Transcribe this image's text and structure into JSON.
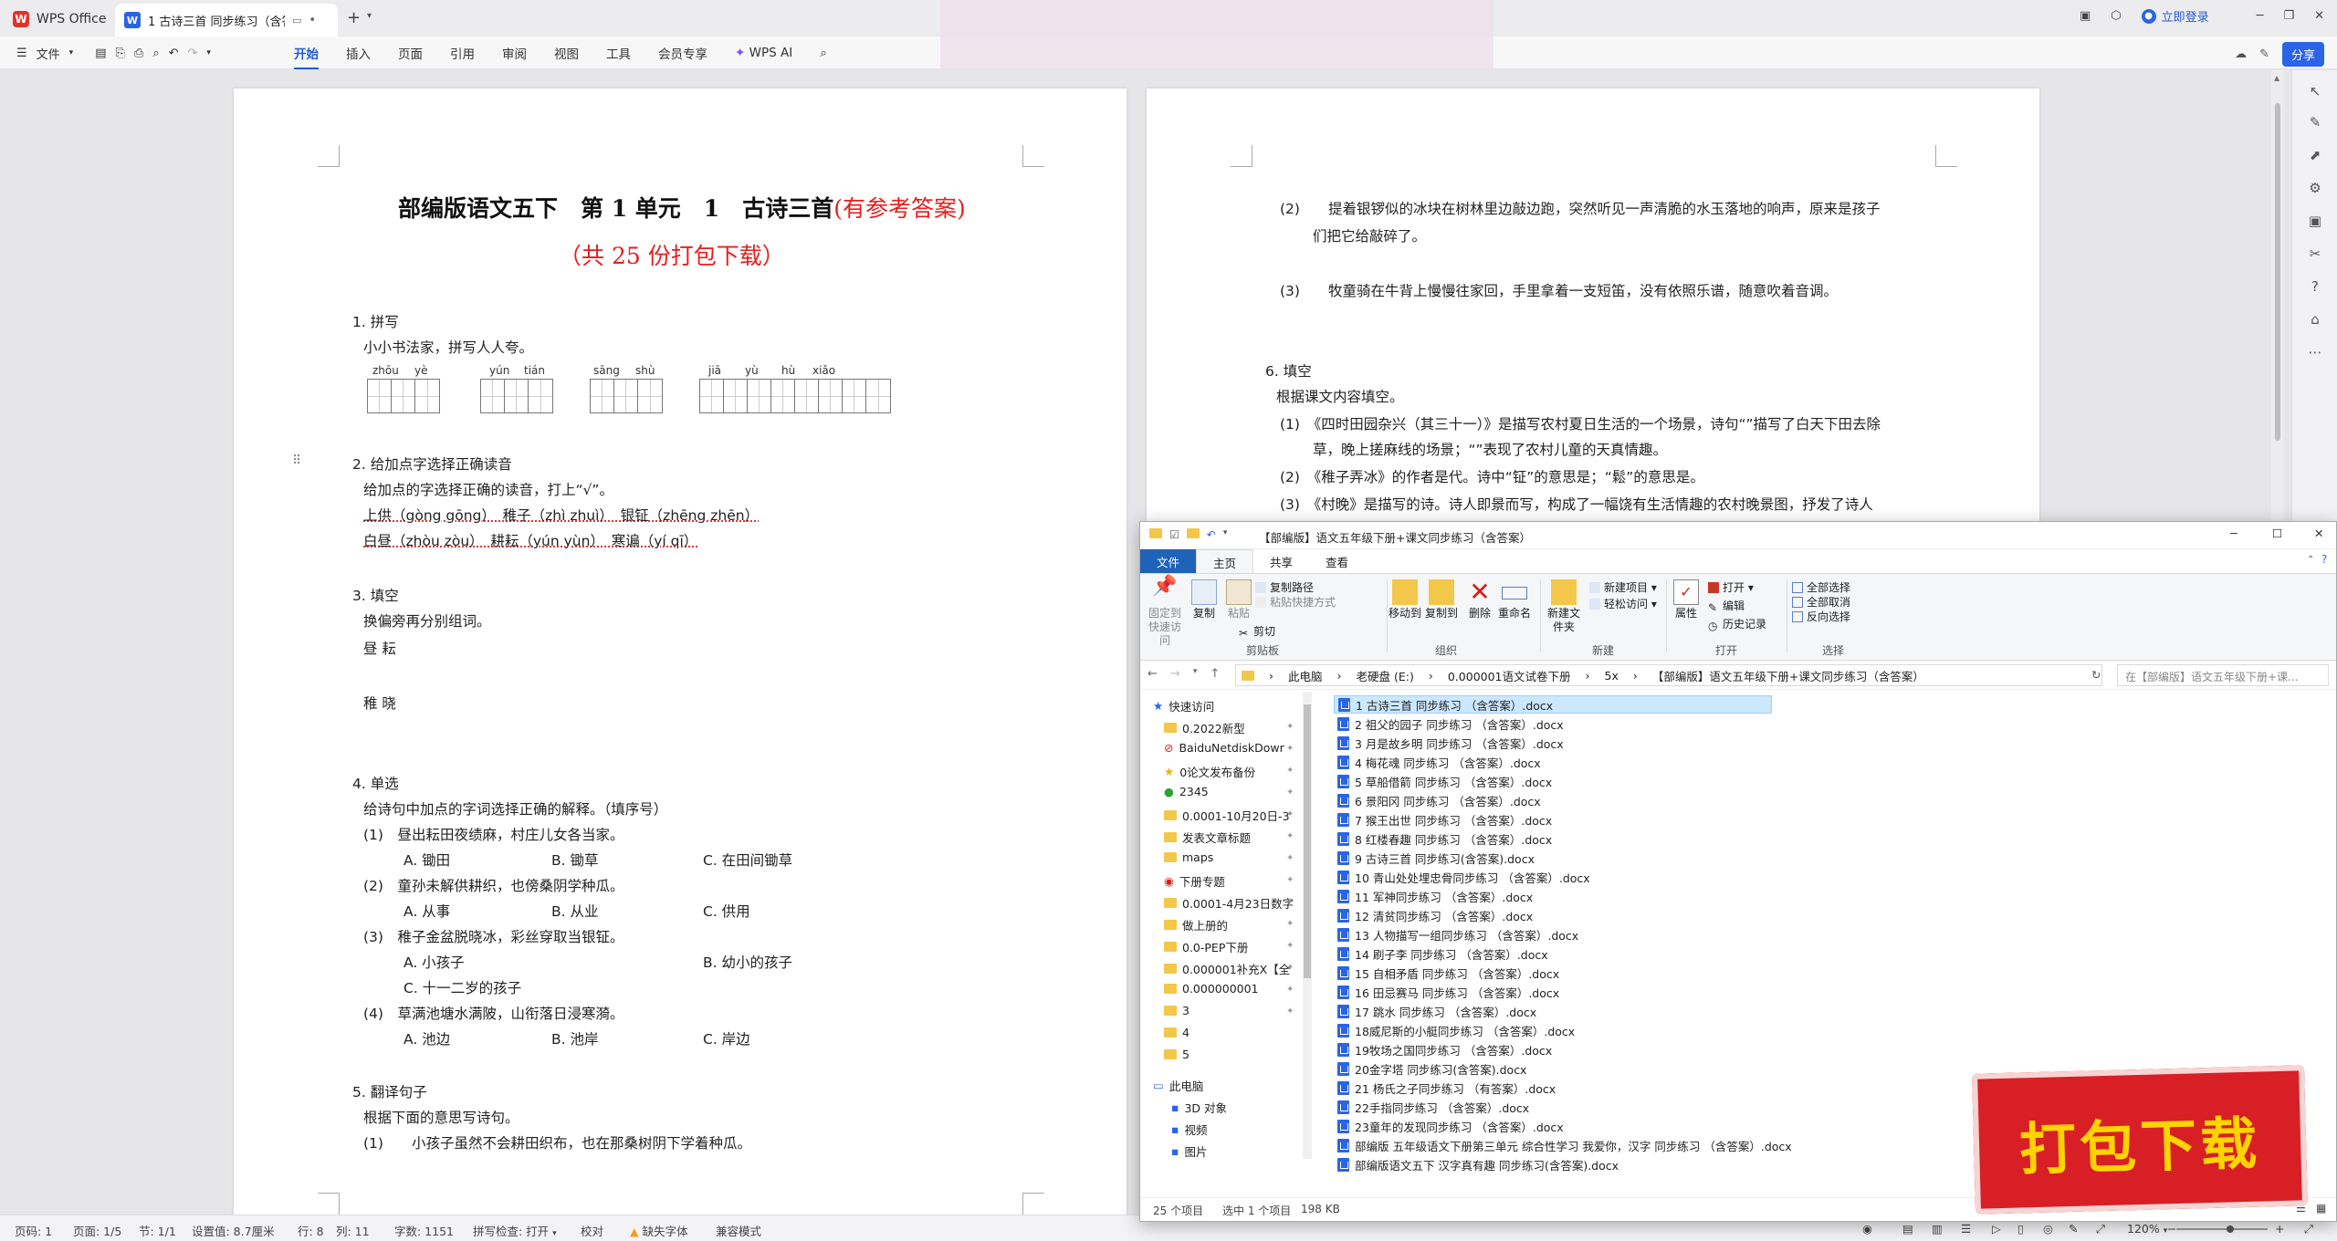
{
  "titlebar": {
    "app_name": "WPS Office",
    "tab_title": "1  古诗三首 同步练习（含答",
    "login": "立即登录"
  },
  "ribbon": {
    "file_menu": "文件",
    "tabs": [
      "开始",
      "插入",
      "页面",
      "引用",
      "审阅",
      "视图",
      "工具",
      "会员专享"
    ],
    "active_tab": "开始",
    "ai": "WPS AI",
    "share": "分享"
  },
  "doc_page1": {
    "title_main": "部编版语文五下　第 1 单元　1　古诗三首",
    "title_red": "(有参考答案)",
    "subtitle": "（共 25 份打包下载）",
    "s1_head": "1. 拼写",
    "s1_intro": "小小书法家，拼写人人夸。",
    "pinyin": [
      "zhōu",
      "yè",
      "yún",
      "tián",
      "sāng",
      "shù",
      "jiā",
      "yù",
      "hù",
      "xiǎo"
    ],
    "s2_head": "2. 给加点字选择正确读音",
    "s2_intro": "给加点的字选择正确的读音，打上“√”。",
    "s2_line1": "上供（gòng gōng）　稚子（zhì zhuì）　银钲（zhēng zhēn）",
    "s2_line2": "白昼（zhòu zòu）　耕耘（yún yùn）　寒谝（yí qī）",
    "s3_head": "3. 填空",
    "s3_intro": "换偏旁再分别组词。",
    "s3_line1": "昼  耘",
    "s3_line2": "稚  晓",
    "s4_head": "4. 单选",
    "s4_intro": "给诗句中加点的字词选择正确的解释。（填序号）",
    "q1": "(1)　昼出耘田夜绩麻，村庄儿女各当家。",
    "q1_opts": [
      "A. 锄田",
      "B. 锄草",
      "C. 在田间锄草"
    ],
    "q2": "(2)　童孙未解供耕织，也傍桑阴学种瓜。",
    "q2_opts": [
      "A. 从事",
      "B. 从业",
      "C. 供用"
    ],
    "q3": "(3)　稚子金盆脱晓冰，彩丝穿取当银钲。",
    "q3_opts": [
      "A. 小孩子",
      "B. 幼小的孩子",
      "C. 十一二岁的孩子"
    ],
    "q4": "(4)　草满池塘水满陂，山衔落日浸寒漪。",
    "q4_opts": [
      "A. 池边",
      "B. 池岸",
      "C. 岸边"
    ],
    "s5_head": "5. 翻译句子",
    "s5_intro": "根据下面的意思写诗句。",
    "s5_q1": "(1)　　小孩子虽然不会耕田织布，也在那桑树阴下学着种瓜。"
  },
  "doc_page2": {
    "p2_l1": "(2)　　提着银锣似的冰块在树林里边敲边跑，突然听见一声清脆的水玉落地的响声，原来是孩子",
    "p2_l2": "们把它给敲碎了。",
    "p3": "(3)　　牧童骑在牛背上慢慢往家回，手里拿着一支短笛，没有依照乐谱，随意吹着音调。",
    "s6_head": "6. 填空",
    "s6_intro": "根据课文内容填空。",
    "s6_q1a": "(1)　《四时田园杂兴（其三十一）》是描写农村夏日生活的一个场景，诗句“”描写了白天下田去除",
    "s6_q1b": "草，晚上搓麻线的场景；“”表现了农村儿童的天真情趣。",
    "s6_q2": "(2)　《稚子弄冰》的作者是代。诗中“钲”的意思是；“鬆”的意思是。",
    "s6_q3": "(3)　《村晚》是描写的诗。诗人即景而写，构成了一幅饶有生活情趣的农村晚景图，抒发了诗人"
  },
  "statusbar": {
    "page_num": "页码: 1",
    "pages": "页面: 1/5",
    "section": "节: 1/1",
    "setting": "设置值: 8.7厘米",
    "row": "行: 8",
    "col": "列: 11",
    "words": "字数: 1151",
    "spell": "拼写检查: 打开",
    "proof": "校对",
    "missing_font": "缺失字体",
    "compat": "兼容模式",
    "zoom": "120%",
    "zoom_level": 0.6
  },
  "explorer": {
    "title": "【部编版】语文五年级下册+课文同步练习（含答案）",
    "tabs": [
      "文件",
      "主页",
      "共享",
      "查看"
    ],
    "groups": {
      "clipboard": "剪贴板",
      "organize": "组织",
      "new": "新建",
      "open": "打开",
      "select": "选择"
    },
    "buttons": {
      "pin": "固定到快速访问",
      "copy": "复制",
      "paste": "粘贴",
      "copy_path": "复制路径",
      "paste_shortcut": "粘贴快捷方式",
      "cut": "剪切",
      "move_to": "移动到",
      "copy_to": "复制到",
      "delete": "删除",
      "rename": "重命名",
      "new_folder": "新建文件夹",
      "new_item": "新建项目",
      "easy_access": "轻松访问",
      "properties": "属性",
      "open": "打开",
      "edit": "编辑",
      "history": "历史记录",
      "select_all": "全部选择",
      "select_none": "全部取消",
      "invert": "反向选择"
    },
    "address": [
      "此电脑",
      "老硬盘 (E:)",
      "0.000001语文试卷下册",
      "5x",
      "【部编版】语文五年级下册+课文同步练习（含答案）"
    ],
    "search_placeholder": "在【部编版】语文五年级下册+课...",
    "nav_items": [
      "快速访问",
      "0.2022新型",
      "BaiduNetdiskDowr",
      "0论文发布备份",
      "2345",
      "0.0001-10月20日-3",
      "发表文章标题",
      "maps",
      "下册专题",
      "0.0001-4月23日数字",
      "做上册的",
      "0.0-PEP下册",
      "0.000001补充X【全",
      "0.000000001",
      "3",
      "4",
      "5",
      "此电脑",
      "3D 对象",
      "视频",
      "图片"
    ],
    "files": [
      "1  古诗三首 同步练习 （含答案）.docx",
      "2  祖父的园子 同步练习 （含答案）.docx",
      "3  月是故乡明 同步练习 （含答案）.docx",
      "4  梅花魂 同步练习 （含答案）.docx",
      "5 草船借箭 同步练习 （含答案）.docx",
      "6 景阳冈 同步练习 （含答案）.docx",
      "7 猴王出世 同步练习 （含答案）.docx",
      "8 红楼春趣 同步练习 （含答案）.docx",
      "9 古诗三首 同步练习(含答案).docx",
      "10  青山处处埋忠骨同步练习 （含答案）.docx",
      "11 军神同步练习 （含答案）.docx",
      "12  清贫同步练习 （含答案）.docx",
      "13  人物描写一组同步练习 （含答案）.docx",
      "14 刷子李 同步练习 （含答案）.docx",
      "15 自相矛盾 同步练习 （含答案）.docx",
      "16 田忌赛马 同步练习 （含答案）.docx",
      "17 跳水 同步练习 （含答案）.docx",
      "18威尼斯的小艇同步练习 （含答案）.docx",
      "19牧场之国同步练习 （含答案）.docx",
      "20金字塔 同步练习(含答案).docx",
      "21 杨氏之子同步练习 （有答案）.docx",
      "22手指同步练习 （含答案）.docx",
      "23童年的发现同步练习 （含答案）.docx",
      "部编版 五年级语文下册第三单元 综合性学习 我爱你，汉字 同步练习 （含答案）.docx",
      "部编版语文五下 汉字真有趣 同步练习(含答案).docx"
    ],
    "status_count": "25 个项目",
    "status_selected": "选中 1 个项目",
    "status_size": "198 KB"
  },
  "promo": "打包下载"
}
